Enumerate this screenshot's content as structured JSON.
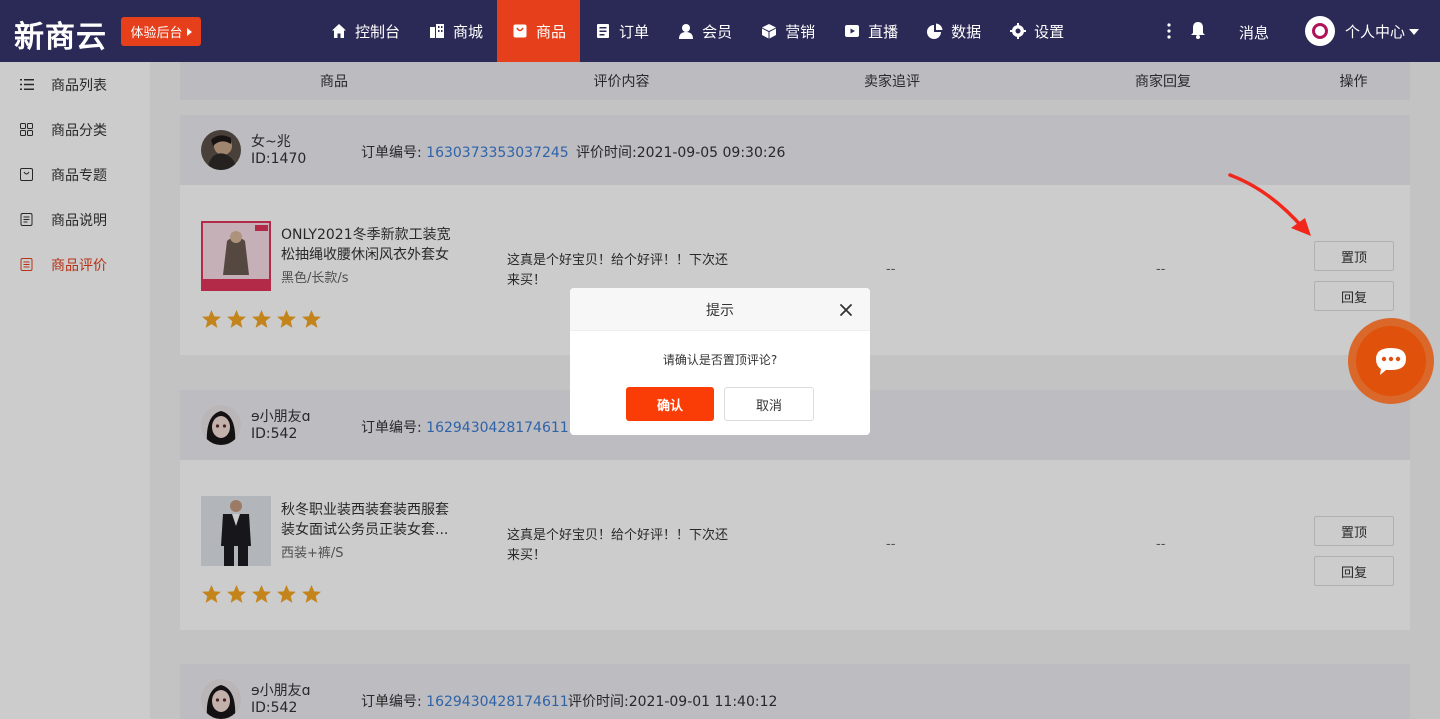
{
  "topbar": {
    "logo": "新商云",
    "trial_button": "体验后台",
    "nav": [
      {
        "label": "控制台",
        "icon": "home-icon"
      },
      {
        "label": "商城",
        "icon": "building-icon"
      },
      {
        "label": "商品",
        "icon": "bag-icon",
        "active": true
      },
      {
        "label": "订单",
        "icon": "clipboard-icon"
      },
      {
        "label": "会员",
        "icon": "user-icon"
      },
      {
        "label": "营销",
        "icon": "cube-icon"
      },
      {
        "label": "直播",
        "icon": "play-icon"
      },
      {
        "label": "数据",
        "icon": "pie-chart-icon"
      },
      {
        "label": "设置",
        "icon": "gear-icon"
      }
    ],
    "messages_label": "消息",
    "user_center_label": "个人中心"
  },
  "sidebar": {
    "items": [
      {
        "label": "商品列表",
        "icon": "list-icon"
      },
      {
        "label": "商品分类",
        "icon": "grid-icon"
      },
      {
        "label": "商品专题",
        "icon": "bag-outline-icon"
      },
      {
        "label": "商品说明",
        "icon": "document-icon"
      },
      {
        "label": "商品评价",
        "icon": "review-icon",
        "active": true
      }
    ]
  },
  "table": {
    "headers": [
      "商品",
      "评价内容",
      "卖家追评",
      "商家回复",
      "操作"
    ]
  },
  "reviews": [
    {
      "name": "女~兆",
      "id": "ID:1470",
      "order_label": "订单编号: ",
      "order_no": "1630373353037245",
      "time": "评价时间:2021-09-05 09:30:26",
      "product_title": "ONLY2021冬季新款工装宽松抽绳收腰休闲风衣外套女",
      "spec": "黑色/长款/s",
      "rating": 5,
      "content": "这真是个好宝贝！给个好评！！下次还来买！",
      "follow": "--",
      "reply": "--",
      "btn_top": "置顶",
      "btn_reply": "回复"
    },
    {
      "name": "ɘ小朋友ɑ",
      "id": "ID:542",
      "order_label": "订单编号: ",
      "order_no": "1629430428174611",
      "time": "",
      "product_title": "秋冬职业装西装套装西服套装女面试公务员正装女套...",
      "spec": "西装+裤/S",
      "rating": 5,
      "content": "这真是个好宝贝！给个好评！！下次还来买！",
      "follow": "--",
      "reply": "--",
      "btn_top": "置顶",
      "btn_reply": "回复"
    },
    {
      "name": "ɘ小朋友ɑ",
      "id": "ID:542",
      "order_label": "订单编号: ",
      "order_no": "1629430428174611",
      "time": "评价时间:2021-09-01 11:40:12"
    }
  ],
  "dialog": {
    "title": "提示",
    "message": "请确认是否置顶评论?",
    "confirm": "确认",
    "cancel": "取消"
  },
  "colors": {
    "nav_bg": "#2b2a56",
    "accent": "#e63f1c",
    "link": "#3b7cd3",
    "star": "#f5a623"
  }
}
